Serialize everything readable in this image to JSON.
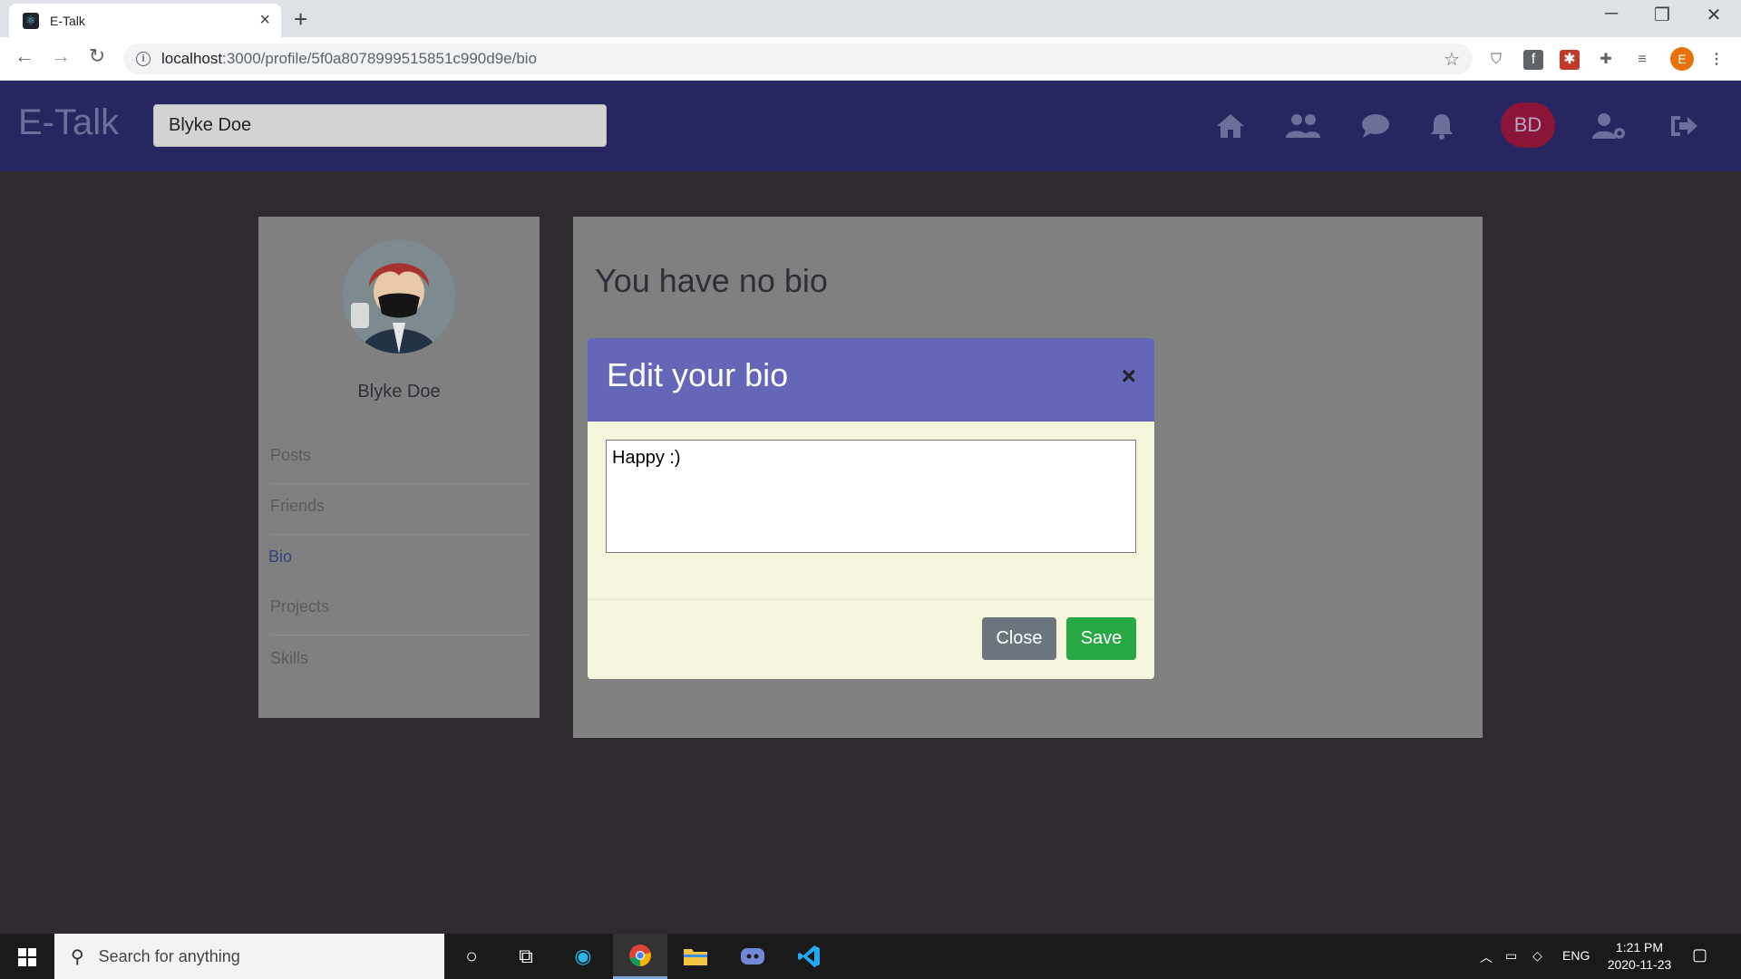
{
  "browser": {
    "tab_title": "E-Talk",
    "url_host": "localhost",
    "url_rest": ":3000/profile/5f0a8078999515851c990d9e/bio",
    "profile_initial": "E"
  },
  "navbar": {
    "brand": "E-Talk",
    "search_value": "Blyke Doe",
    "avatar_initials": "BD",
    "icons": [
      "home-icon",
      "friends-icon",
      "chat-icon",
      "bell-icon",
      "user-settings-icon",
      "logout-icon"
    ]
  },
  "sidebar": {
    "username": "Blyke Doe",
    "items": [
      {
        "label": "Posts",
        "active": false
      },
      {
        "label": "Friends",
        "active": false
      },
      {
        "label": "Bio",
        "active": true
      },
      {
        "label": "Projects",
        "active": false
      },
      {
        "label": "Skills",
        "active": false
      }
    ]
  },
  "main": {
    "no_bio_text": "You have no bio"
  },
  "modal": {
    "title": "Edit your bio",
    "close_symbol": "×",
    "bio_value": "Happy :)",
    "close_label": "Close",
    "save_label": "Save"
  },
  "taskbar": {
    "search_placeholder": "Search for anything",
    "language": "ENG",
    "time": "1:21 PM",
    "date": "2020-11-23"
  },
  "colors": {
    "navbar_bg": "#282660",
    "modal_header": "#6467b8",
    "modal_body": "#f5f5dc",
    "save_button": "#28a745",
    "close_button": "#6c757d",
    "avatar_bg": "#8a1538"
  }
}
